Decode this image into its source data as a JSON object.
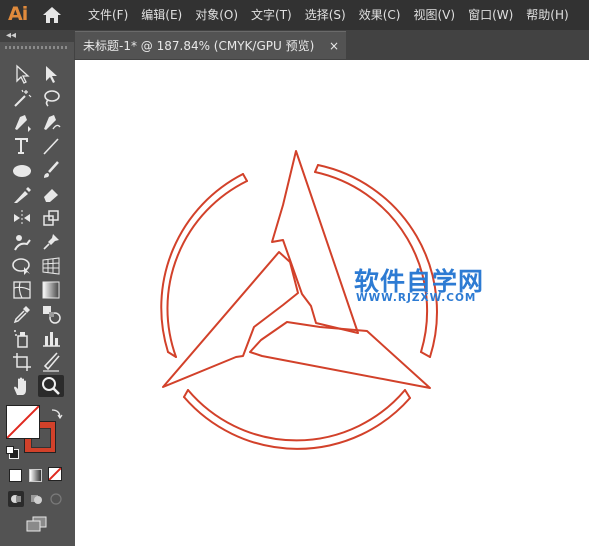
{
  "app": {
    "logo": "Ai"
  },
  "menu": [
    "文件(F)",
    "编辑(E)",
    "对象(O)",
    "文字(T)",
    "选择(S)",
    "效果(C)",
    "视图(V)",
    "窗口(W)",
    "帮助(H)"
  ],
  "panel": {
    "collapse_glyph": "◂◂"
  },
  "document_tab": {
    "title": "未标题-1* @ 187.84% (CMYK/GPU 预览)",
    "close": "×"
  },
  "tools": [
    "selection-tool",
    "direct-selection-tool",
    "magic-wand-tool",
    "lasso-tool",
    "pen-tool",
    "curvature-tool",
    "type-tool",
    "line-segment-tool",
    "ellipse-tool",
    "paintbrush-tool",
    "shaper-tool",
    "eraser-tool",
    "rotate-tool",
    "scale-tool",
    "puppet-warp-tool",
    "pin-tool",
    "free-transform-tool",
    "perspective-grid-tool",
    "mesh-tool",
    "gradient-tool",
    "eyedropper-tool",
    "blend-tool",
    "symbol-sprayer-tool",
    "column-graph-tool",
    "artboard-tool",
    "slice-tool",
    "hand-tool",
    "zoom-tool"
  ],
  "selected_tool": "zoom-tool",
  "colors": {
    "fill": "none",
    "stroke": "#d2412a",
    "accent_logo": "#e08a3c",
    "watermark": "#2d7bd3"
  },
  "watermark": {
    "cn": "软件自学网",
    "url": "WWW.RJZXW.COM"
  }
}
